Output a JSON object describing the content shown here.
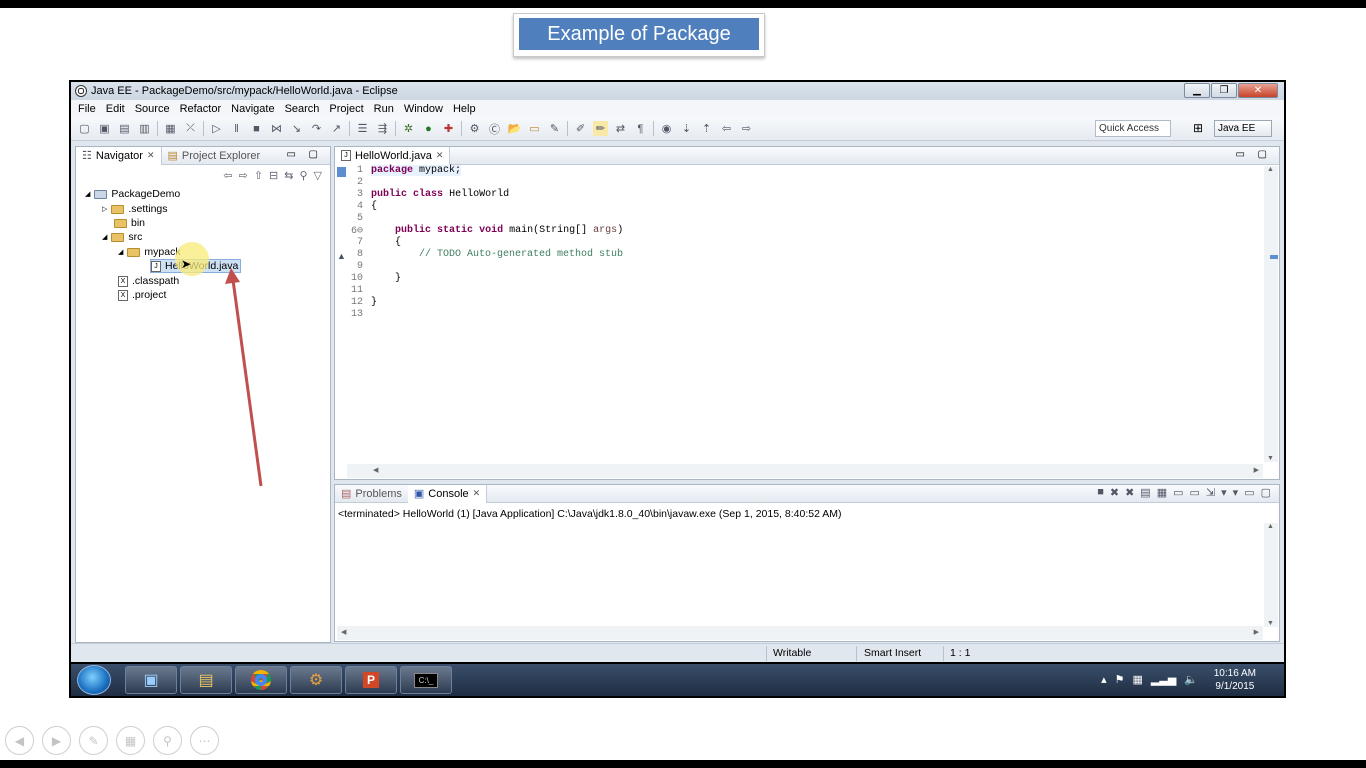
{
  "slide": {
    "title": "Example of Package"
  },
  "window": {
    "title": "Java EE - PackageDemo/src/mypack/HelloWorld.java - Eclipse"
  },
  "menu": [
    "File",
    "Edit",
    "Source",
    "Refactor",
    "Navigate",
    "Search",
    "Project",
    "Run",
    "Window",
    "Help"
  ],
  "toolbar": {
    "quick_access": "Quick Access",
    "perspective": "Java EE"
  },
  "navigator": {
    "tabs": [
      "Navigator",
      "Project Explorer"
    ],
    "tree": {
      "project": "PackageDemo",
      "settings": ".settings",
      "bin": "bin",
      "src": "src",
      "package": "mypack",
      "file": "HelloWorld.java",
      "classpath": ".classpath",
      "projectfile": ".project"
    }
  },
  "editor": {
    "tab": "HelloWorld.java",
    "lines": [
      {
        "n": "1",
        "html": "package mypack;"
      },
      {
        "n": "2",
        "html": ""
      },
      {
        "n": "3",
        "html": "public class HelloWorld"
      },
      {
        "n": "4",
        "html": "{"
      },
      {
        "n": "5",
        "html": ""
      },
      {
        "n": "6⊖",
        "html": "    public static void main(String[] args)"
      },
      {
        "n": "7",
        "html": "    {"
      },
      {
        "n": "8",
        "html": "        // TODO Auto-generated method stub"
      },
      {
        "n": "9",
        "html": ""
      },
      {
        "n": "10",
        "html": "    }"
      },
      {
        "n": "11",
        "html": ""
      },
      {
        "n": "12",
        "html": "}"
      },
      {
        "n": "13",
        "html": ""
      }
    ]
  },
  "console": {
    "tabs": [
      "Problems",
      "Console"
    ],
    "terminated": "<terminated> HelloWorld (1) [Java Application] C:\\Java\\jdk1.8.0_40\\bin\\javaw.exe (Sep 1, 2015, 8:40:52 AM)"
  },
  "status": {
    "writable": "Writable",
    "insert": "Smart Insert",
    "position": "1 : 1"
  },
  "taskbar": {
    "time": "10:16 AM",
    "date": "9/1/2015"
  },
  "colors": {
    "slide_title_bg": "#4f7fbd",
    "keyword": "#7f0055",
    "comment": "#3f7f5f"
  }
}
